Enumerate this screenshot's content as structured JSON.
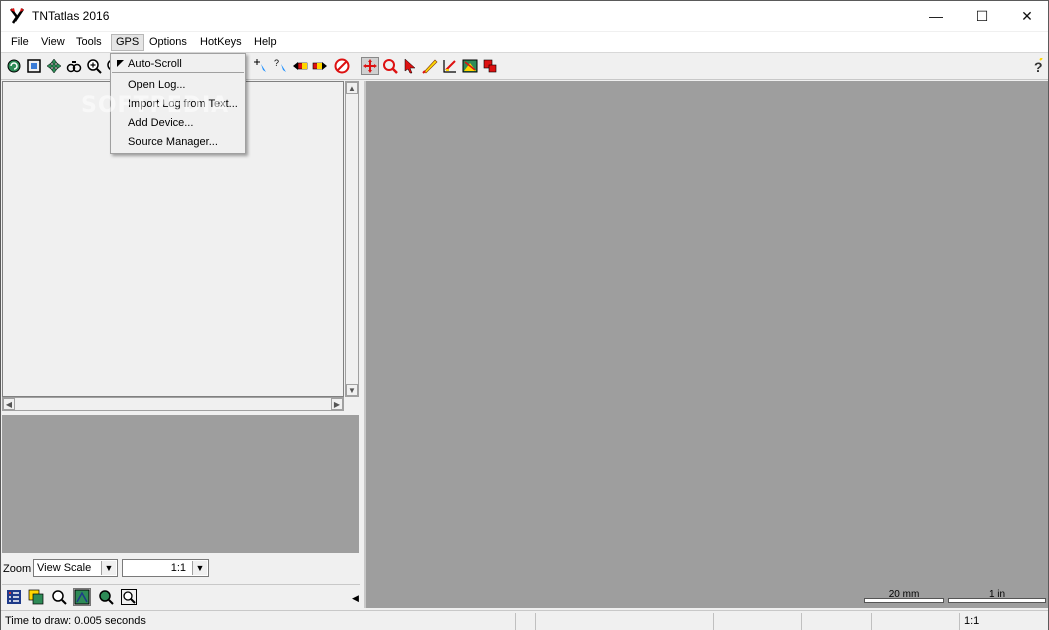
{
  "window": {
    "title": "TNTatlas 2016",
    "controls": {
      "minimize": "—",
      "maximize": "☐",
      "close": "✕"
    }
  },
  "menubar": {
    "items": [
      "File",
      "View",
      "Tools",
      "GPS",
      "Options",
      "HotKeys",
      "Help"
    ],
    "active": "GPS"
  },
  "gps_menu": {
    "items": [
      {
        "label": "Auto-Scroll",
        "checked": true
      },
      {
        "label": "Open Log..."
      },
      {
        "label": "Import Log from Text..."
      },
      {
        "label": "Add Device..."
      },
      {
        "label": "Source Manager..."
      }
    ]
  },
  "toolbar": {
    "icons": [
      "redraw-icon",
      "full-view-icon",
      "pan-icon",
      "link-icon",
      "zoom-in-icon",
      "zoom-out-icon",
      "add-point-icon",
      "query-icon",
      "prev-view-icon",
      "next-view-icon",
      "stop-icon",
      "move-icon",
      "zoom-box-icon",
      "select-icon",
      "measure-icon",
      "sketch-icon",
      "image-icon",
      "layers-icon",
      "help-icon"
    ]
  },
  "left_panel": {
    "zoom_label": "Zoom",
    "zoom_mode": "View Scale",
    "scale_value": "1:1",
    "bottom_icons": [
      "legend-icon",
      "layer-controls-icon",
      "find-icon",
      "overview-icon",
      "zoom-to-layer-icon",
      "zoom-selected-icon"
    ]
  },
  "map": {
    "background": "#9e9e9e",
    "scalebars": [
      "20 mm",
      "1 in"
    ]
  },
  "statusbar": {
    "message": "Time to draw: 0.005 seconds",
    "scale": "1:1"
  },
  "watermark": "SOFTPEDIA"
}
